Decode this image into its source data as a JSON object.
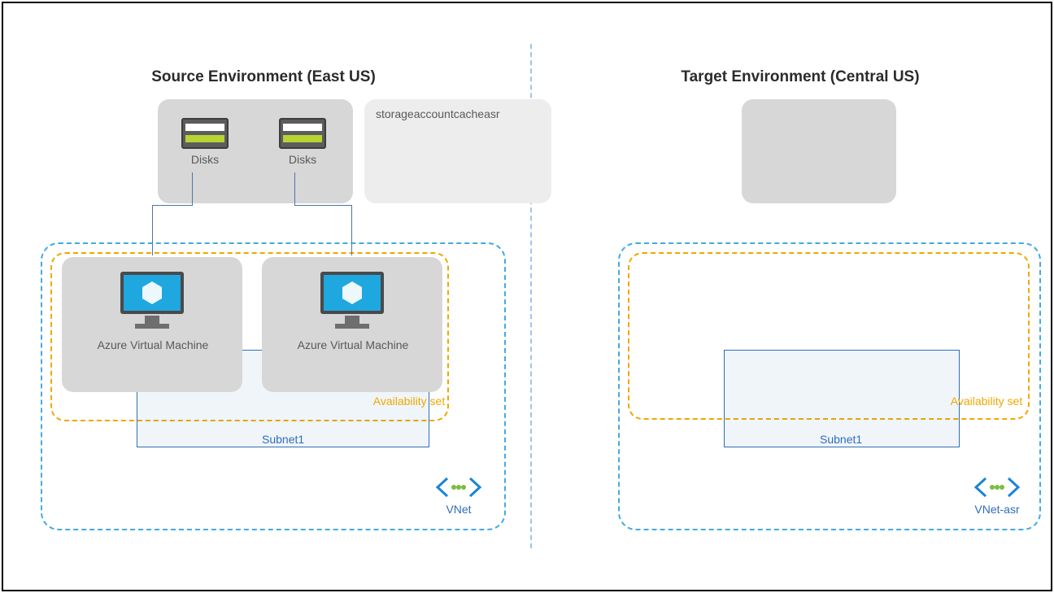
{
  "source": {
    "title": "Source Environment (East US)",
    "disks_label": "Disks",
    "storage_cache": "storageaccountcacheasr",
    "vm_label": "Azure Virtual Machine",
    "availability_set": "Availability set",
    "subnet": "Subnet1",
    "vnet": "VNet"
  },
  "target": {
    "title": "Target Environment (Central US)",
    "availability_set": "Availability set",
    "subnet": "Subnet1",
    "vnet": "VNet-asr"
  }
}
